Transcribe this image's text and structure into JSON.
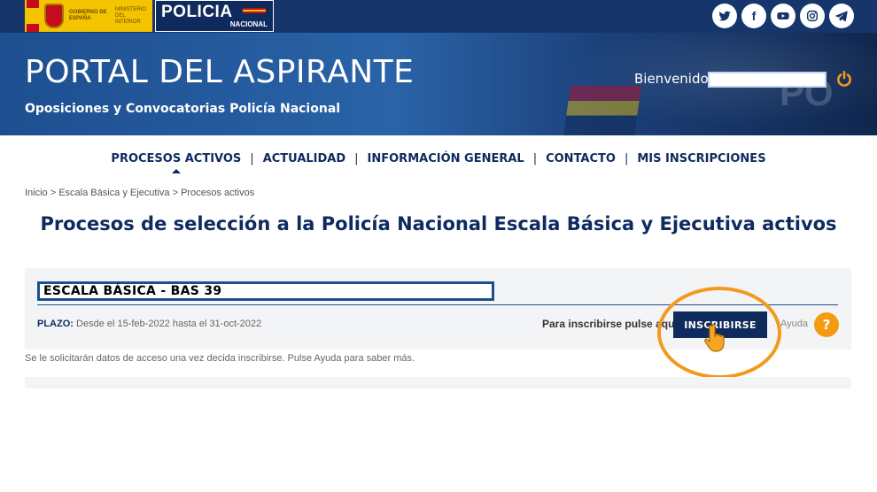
{
  "gov": {
    "gobierno": "GOBIERNO DE ESPAÑA",
    "ministerio": "MINISTERIO DEL INTERIOR"
  },
  "pn_logo": {
    "main": "POLICIA",
    "sub": "NACIONAL"
  },
  "social": [
    {
      "name": "twitter-icon"
    },
    {
      "name": "facebook-icon",
      "glyph": "f"
    },
    {
      "name": "youtube-icon"
    },
    {
      "name": "instagram-icon"
    },
    {
      "name": "telegram-icon"
    }
  ],
  "header": {
    "title": "PORTAL DEL ASPIRANTE",
    "subtitle": "Oposiciones y Convocatorias Policía Nacional",
    "welcome": "Bienvenido,"
  },
  "nav": {
    "items": [
      {
        "label": "PROCESOS ACTIVOS",
        "active": true
      },
      {
        "label": "ACTUALIDAD"
      },
      {
        "label": "INFORMACIÓN GENERAL"
      },
      {
        "label": "CONTACTO"
      },
      {
        "label": "MIS INSCRIPCIONES"
      }
    ],
    "separator": "|"
  },
  "breadcrumb": "Inicio > Escala Básica y Ejecutiva > Procesos activos",
  "page_title": "Procesos de selección a la Policía Nacional Escala Básica y Ejecutiva activos",
  "card": {
    "title": "ESCALA BÁSICA - BAS 39",
    "plazo_label": "PLAZO:",
    "plazo_text": " Desde el 15-feb-2022 hasta el 31-oct-2022",
    "prompt": "Para inscribirse pulse aquí",
    "button": "INSCRIBIRSE",
    "ayuda": "Ayuda",
    "help_glyph": "?"
  },
  "info_note": "Se le solicitarán datos de acceso una vez decida inscribirse. Pulse Ayuda para saber más.",
  "colors": {
    "navy": "#0e2a5e",
    "banner": "#1d4f90",
    "accent_orange": "#f39a1e"
  }
}
